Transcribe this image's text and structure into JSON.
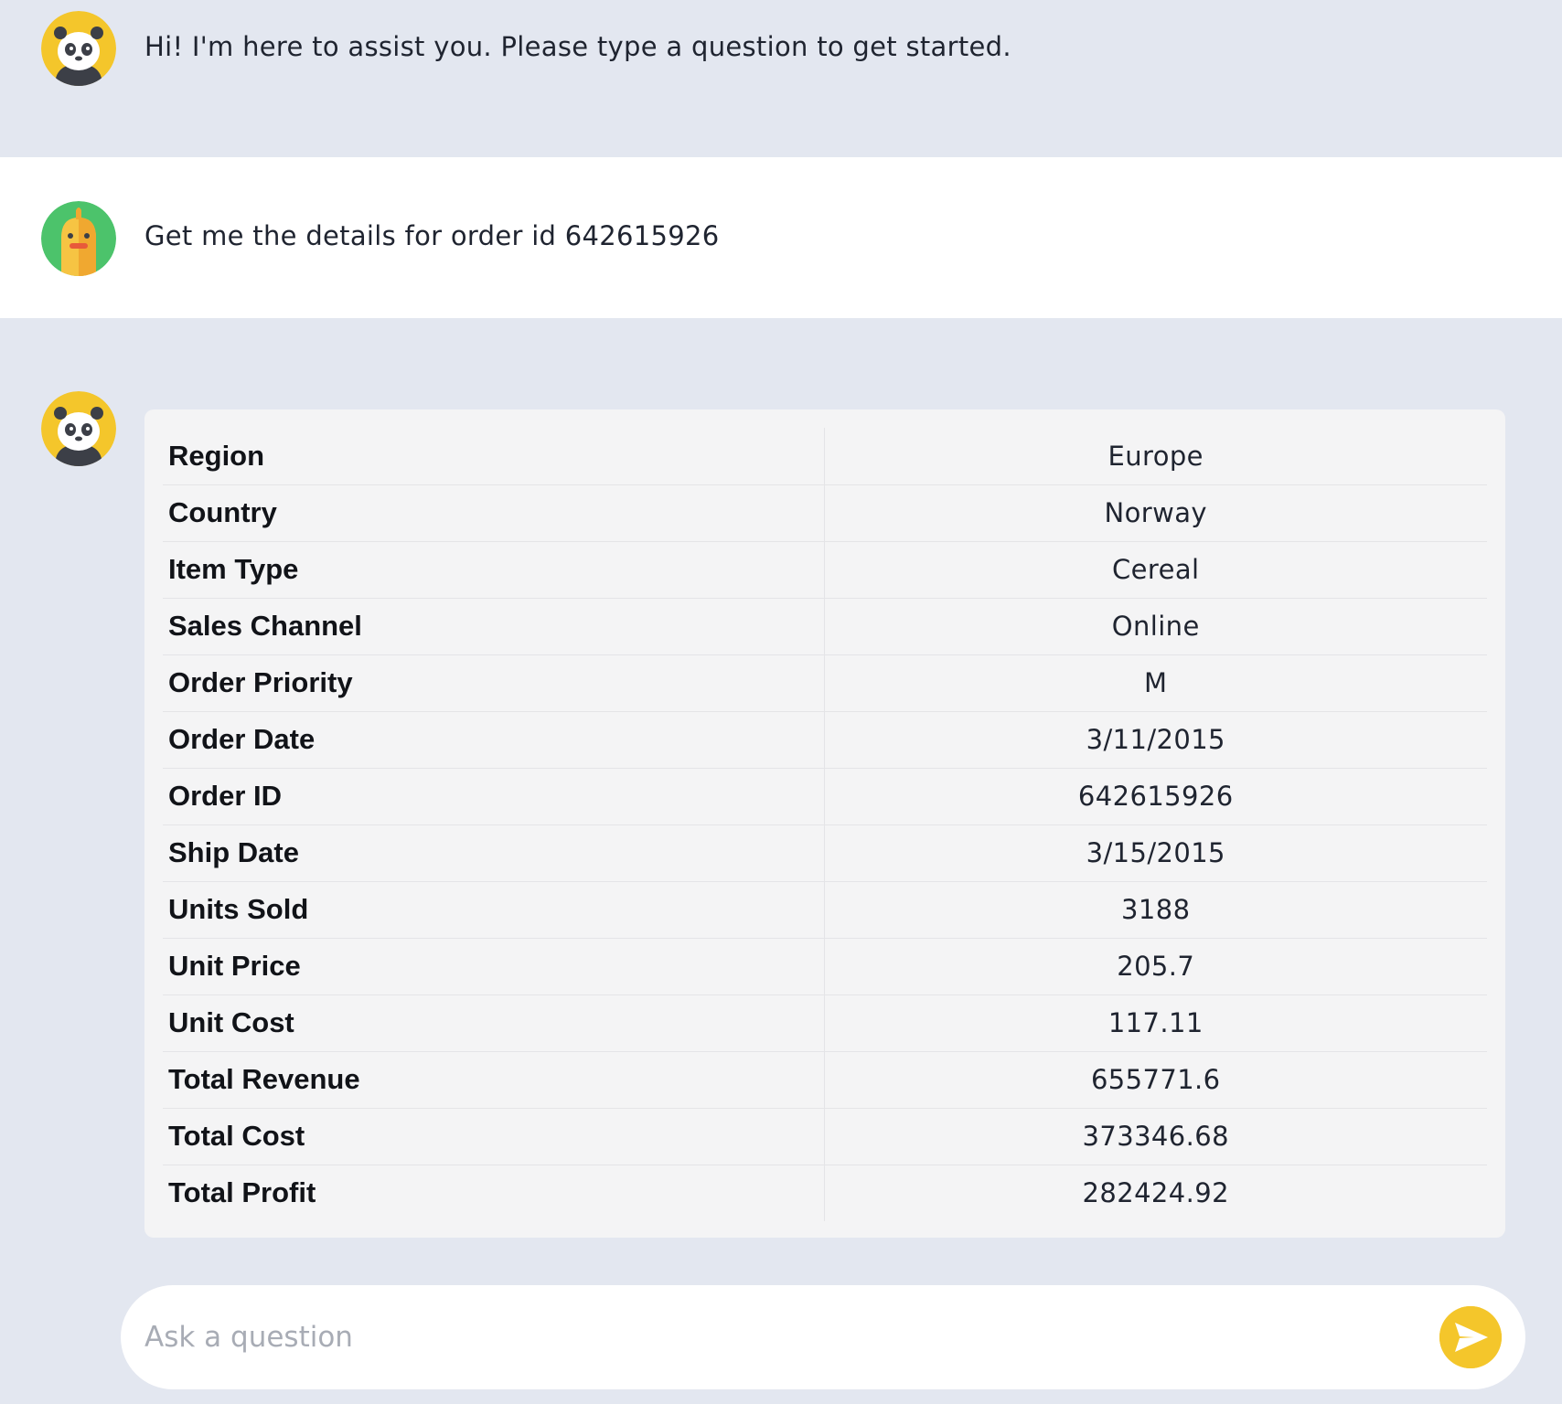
{
  "messages": {
    "greeting": {
      "avatar": "panda-icon",
      "text": "Hi! I'm here to assist you. Please type a question to get started."
    },
    "user_query": {
      "avatar": "duck-icon",
      "text": "Get me the details for order id 642615926"
    },
    "bot_answer": {
      "avatar": "panda-icon",
      "rows": [
        {
          "key": "Region",
          "value": "Europe"
        },
        {
          "key": "Country",
          "value": "Norway"
        },
        {
          "key": "Item Type",
          "value": "Cereal"
        },
        {
          "key": "Sales Channel",
          "value": "Online"
        },
        {
          "key": "Order Priority",
          "value": "M"
        },
        {
          "key": "Order Date",
          "value": "3/11/2015"
        },
        {
          "key": "Order ID",
          "value": "642615926"
        },
        {
          "key": "Ship Date",
          "value": "3/15/2015"
        },
        {
          "key": "Units Sold",
          "value": "3188"
        },
        {
          "key": "Unit Price",
          "value": "205.7"
        },
        {
          "key": "Unit Cost",
          "value": "117.11"
        },
        {
          "key": "Total Revenue",
          "value": "655771.6"
        },
        {
          "key": "Total Cost",
          "value": "373346.68"
        },
        {
          "key": "Total Profit",
          "value": "282424.92"
        }
      ]
    }
  },
  "input": {
    "placeholder": "Ask a question",
    "value": "",
    "send_icon": "send-icon"
  },
  "colors": {
    "background": "#e3e7f0",
    "user_row": "#ffffff",
    "card": "#f4f4f5",
    "accent": "#f4c62b",
    "duck_bg": "#4cc36b"
  }
}
